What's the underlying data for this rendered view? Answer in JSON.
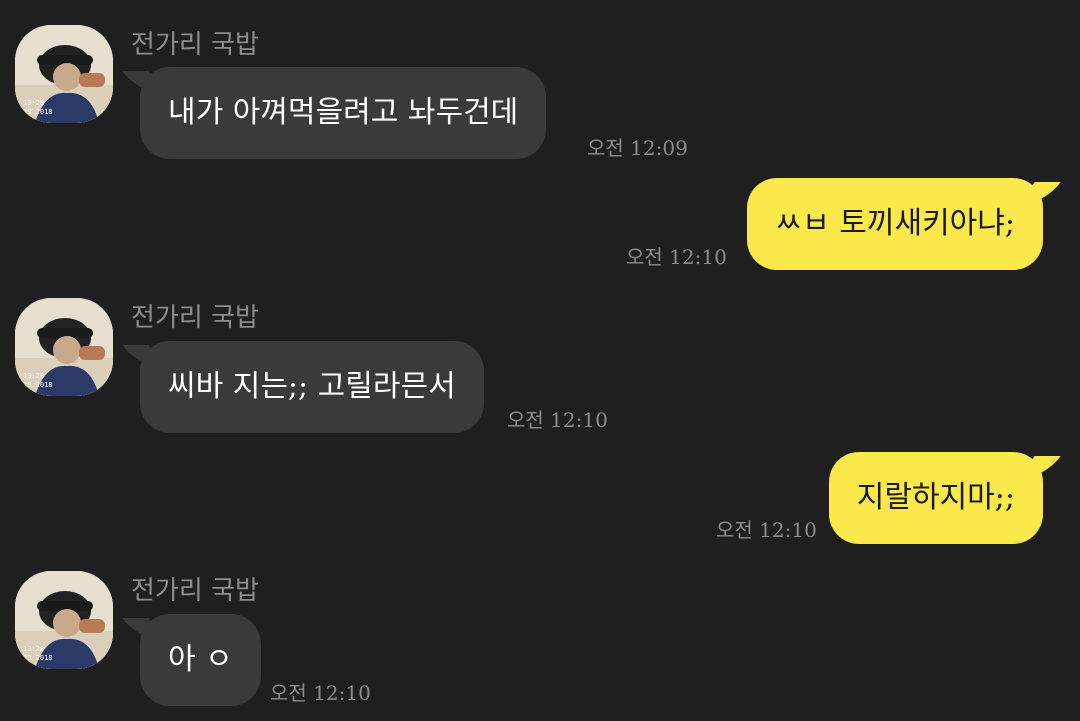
{
  "sender_name": "전가리 국밥",
  "avatar_caption_line1": "13:28",
  "avatar_caption_line2": "29 2018",
  "messages": [
    {
      "direction": "in",
      "text": "내가 아껴먹을려고 놔두건데",
      "time": "오전 12:09"
    },
    {
      "direction": "out",
      "text": "ㅆㅂ 토끼새키아냐;",
      "time": "오전 12:10"
    },
    {
      "direction": "in",
      "text": "씨바 지는;; 고릴라믄서",
      "time": "오전 12:10"
    },
    {
      "direction": "out",
      "text": "지랄하지마;;",
      "time": "오전 12:10"
    },
    {
      "direction": "in",
      "text": "아 ㅇ",
      "time": "오전 12:10"
    }
  ],
  "colors": {
    "background": "#1f1f1f",
    "incoming_bubble": "#3a3a3a",
    "outgoing_bubble": "#fbe84a",
    "meta_text": "#8c8c8c"
  }
}
